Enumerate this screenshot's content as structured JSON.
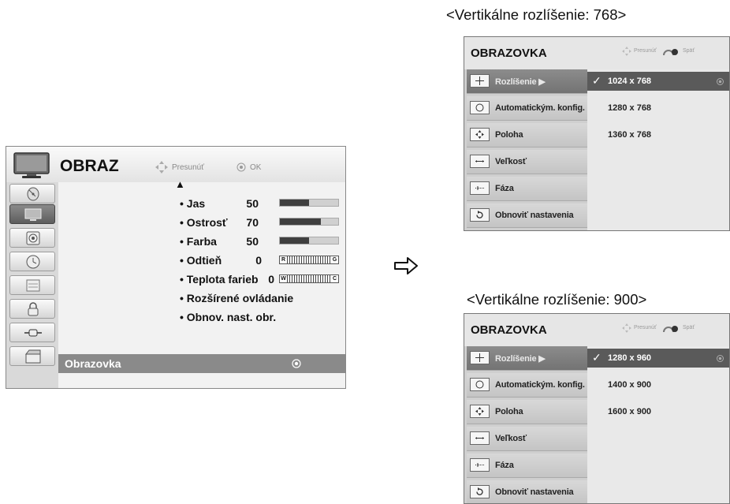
{
  "main_menu": {
    "title": "OBRAZ",
    "hint_move": "Presunúť",
    "hint_ok": "OK",
    "sidebar_icons": [
      "satellite-icon",
      "tv-icon",
      "speaker-icon",
      "clock-icon",
      "option-icon",
      "lock-icon",
      "input-icon",
      "usb-icon"
    ],
    "selected_sidebar_index": 1,
    "settings": [
      {
        "label": "• Jas",
        "value": "50",
        "level": 0.5
      },
      {
        "label": "• Ostrosť",
        "value": "70",
        "level": 0.7
      },
      {
        "label": "• Farba",
        "value": "50",
        "level": 0.5
      },
      {
        "label": "• Odtieň",
        "value": "0",
        "scale_left": "R",
        "scale_right": "G"
      },
      {
        "label": "• Teplota farieb",
        "value": "0",
        "scale_left": "W",
        "scale_right": "C"
      },
      {
        "label": "• Rozšírené ovládanie"
      },
      {
        "label": "• Obnov. nast. obr."
      }
    ],
    "selected_item": "Obrazovka"
  },
  "panels": [
    {
      "caption": "<Vertikálne rozlíšenie: 768>",
      "title": "OBRAZOVKA",
      "hint_move": "Presunúť",
      "hint_back": "Späť",
      "menu": [
        {
          "label": "Rozlíšenie ▶",
          "icon": "move-icon"
        },
        {
          "label": "Automatickým. konfig.",
          "icon": "auto-config-icon"
        },
        {
          "label": "Poloha",
          "icon": "position-icon"
        },
        {
          "label": "Veľkosť",
          "icon": "size-icon"
        },
        {
          "label": "Fáza",
          "icon": "phase-icon"
        },
        {
          "label": "Obnoviť nastavenia",
          "icon": "reset-icon"
        }
      ],
      "options": [
        "1024 x 768",
        "1280 x 768",
        "1360 x 768"
      ],
      "selected_option_index": 0,
      "check": "✓"
    },
    {
      "caption": "<Vertikálne rozlíšenie: 900>",
      "title": "OBRAZOVKA",
      "hint_move": "Presunúť",
      "hint_back": "Späť",
      "menu": [
        {
          "label": "Rozlíšenie ▶",
          "icon": "move-icon"
        },
        {
          "label": "Automatickým. konfig.",
          "icon": "auto-config-icon"
        },
        {
          "label": "Poloha",
          "icon": "position-icon"
        },
        {
          "label": "Veľkosť",
          "icon": "size-icon"
        },
        {
          "label": "Fáza",
          "icon": "phase-icon"
        },
        {
          "label": "Obnoviť nastavenia",
          "icon": "reset-icon"
        }
      ],
      "options": [
        "1280 x 960",
        "1400 x 900",
        "1600 x 900"
      ],
      "selected_option_index": 0,
      "check": "✓"
    }
  ]
}
